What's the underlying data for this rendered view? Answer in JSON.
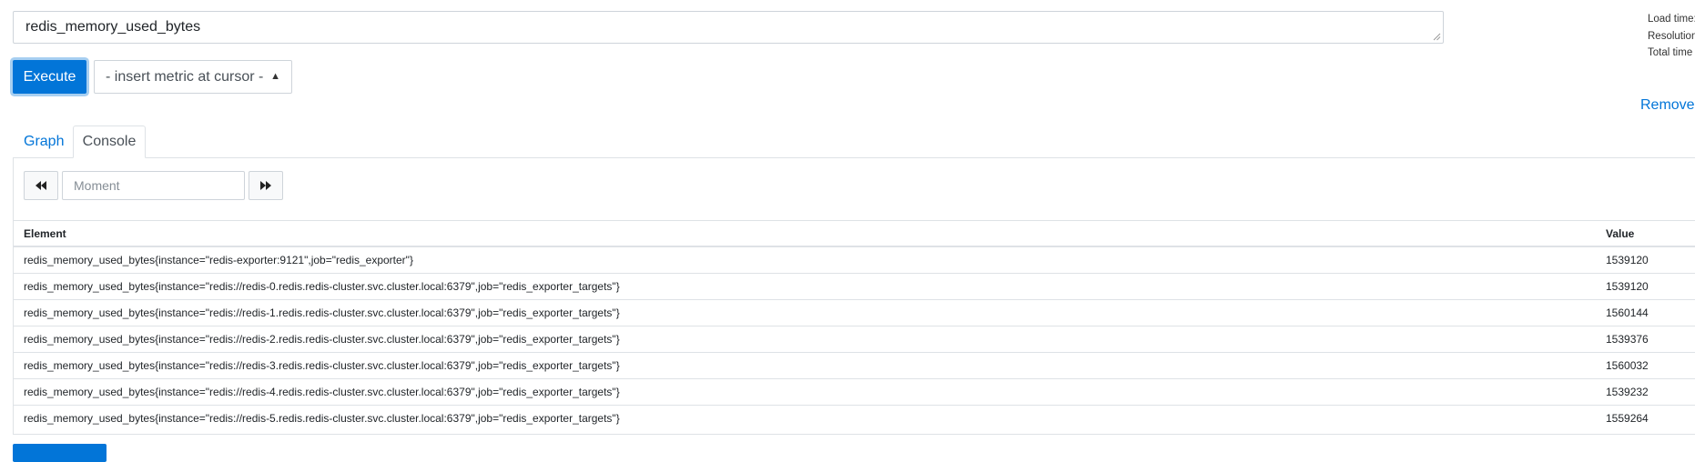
{
  "query": {
    "expression": "redis_memory_used_bytes"
  },
  "toolbar": {
    "execute_label": "Execute",
    "insert_metric_label": "- insert metric at cursor -"
  },
  "stats": {
    "load_time_label": "Load time:",
    "resolution_label": "Resolution:",
    "total_time_label": "Total time"
  },
  "panel": {
    "remove_label": "Remove"
  },
  "tabs": [
    {
      "label": "Graph",
      "active": false
    },
    {
      "label": "Console",
      "active": true
    }
  ],
  "console": {
    "moment_placeholder": "Moment"
  },
  "table": {
    "headers": [
      "Element",
      "Value"
    ],
    "rows": [
      {
        "element": "redis_memory_used_bytes{instance=\"redis-exporter:9121\",job=\"redis_exporter\"}",
        "value": "1539120"
      },
      {
        "element": "redis_memory_used_bytes{instance=\"redis://redis-0.redis.redis-cluster.svc.cluster.local:6379\",job=\"redis_exporter_targets\"}",
        "value": "1539120"
      },
      {
        "element": "redis_memory_used_bytes{instance=\"redis://redis-1.redis.redis-cluster.svc.cluster.local:6379\",job=\"redis_exporter_targets\"}",
        "value": "1560144"
      },
      {
        "element": "redis_memory_used_bytes{instance=\"redis://redis-2.redis.redis-cluster.svc.cluster.local:6379\",job=\"redis_exporter_targets\"}",
        "value": "1539376"
      },
      {
        "element": "redis_memory_used_bytes{instance=\"redis://redis-3.redis.redis-cluster.svc.cluster.local:6379\",job=\"redis_exporter_targets\"}",
        "value": "1560032"
      },
      {
        "element": "redis_memory_used_bytes{instance=\"redis://redis-4.redis.redis-cluster.svc.cluster.local:6379\",job=\"redis_exporter_targets\"}",
        "value": "1539232"
      },
      {
        "element": "redis_memory_used_bytes{instance=\"redis://redis-5.redis.redis-cluster.svc.cluster.local:6379\",job=\"redis_exporter_targets\"}",
        "value": "1559264"
      }
    ]
  },
  "colors": {
    "accent": "#0275d8",
    "border": "#dee2e6"
  },
  "icons": {
    "prev": "fast-backward-icon",
    "next": "fast-forward-icon",
    "select": "sort-caret-icon"
  }
}
